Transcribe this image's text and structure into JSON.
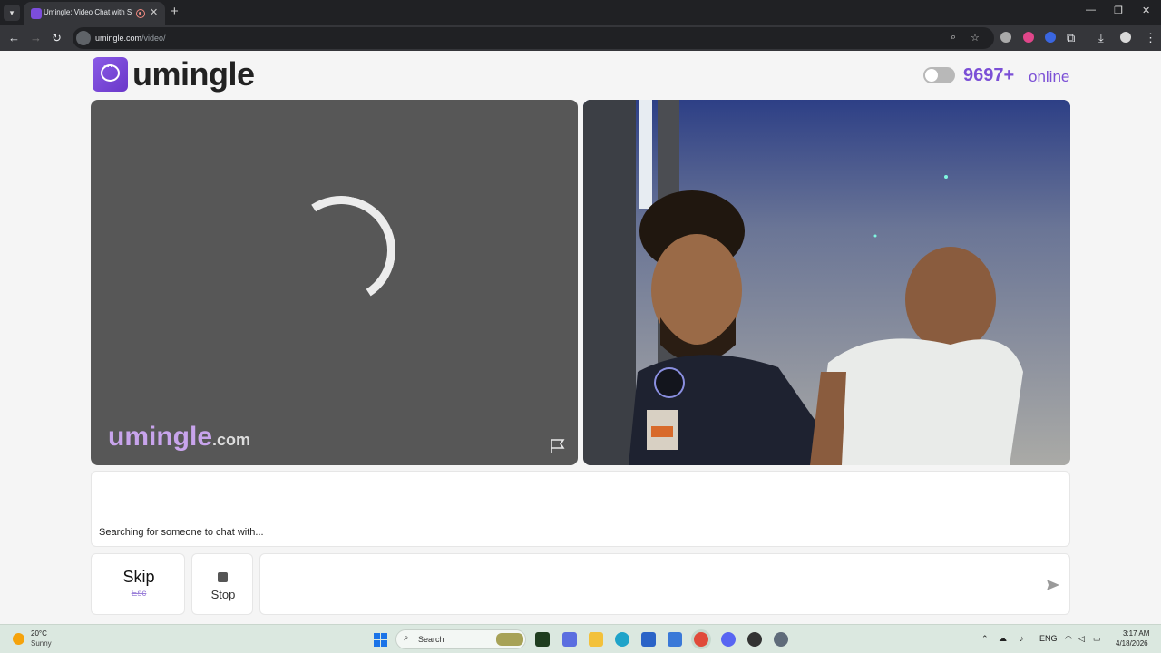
{
  "browser": {
    "tab_title": "Umingle: Video Chat with Strangers",
    "url_host": "umingle.com",
    "url_path": "/video/"
  },
  "header": {
    "logo_text": "umingle",
    "online_count": "9697+",
    "online_label": "online"
  },
  "stranger_video": {
    "watermark_name": "umingle",
    "watermark_tld": ".com"
  },
  "chat": {
    "status": "Searching for someone to chat with...",
    "input_value": "",
    "input_placeholder": ""
  },
  "controls": {
    "skip_label": "Skip",
    "skip_hint": "Esc",
    "stop_label": "Stop"
  },
  "taskbar": {
    "weather_temp": "20°C",
    "weather_condition": "Sunny",
    "search_label": "Search",
    "language": "ENG",
    "time": "3:17 AM",
    "date": "4/18/2026"
  },
  "colors": {
    "brand_purple": "#7b4fd6",
    "video_bg": "#575757",
    "page_bg": "#f5f5f5"
  }
}
